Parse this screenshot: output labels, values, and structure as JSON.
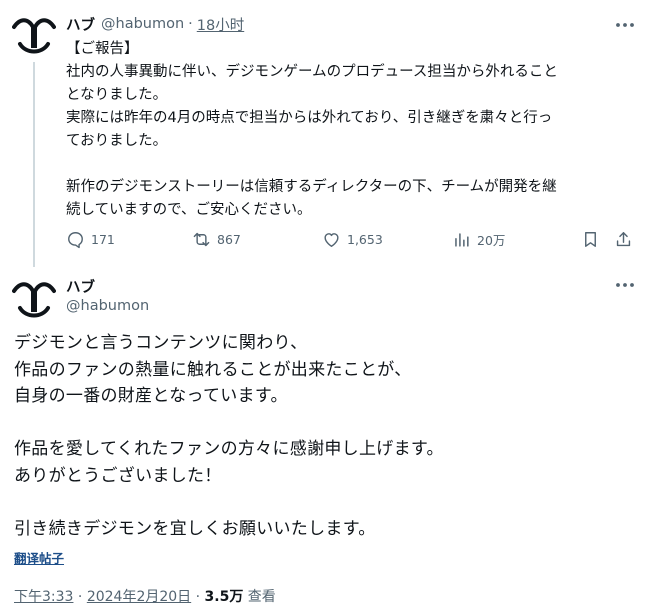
{
  "colors": {
    "text": "#0f1419",
    "secondary": "#536471",
    "line": "#cfd9de",
    "link": "#1d4e89"
  },
  "tweet1": {
    "author_name": "ハブ",
    "handle": "@habumon",
    "separator": "·",
    "time": "18小时",
    "avatar_icon": "avatar-logo-icon",
    "more_icon": "more-dots-icon",
    "body_lines": [
      "【ご報告】",
      "社内の人事異動に伴い、デジモンゲームのプロデュース担当から外れること",
      "となりました。",
      "実際には昨年の4月の時点で担当からは外れており、引き継ぎを粛々と行っ",
      "ておりました。",
      "",
      "新作のデジモンストーリーは信頼するディレクターの下、チームが開発を継",
      "続していますので、ご安心ください。"
    ],
    "actions": {
      "reply_count": "171",
      "retweet_count": "867",
      "like_count": "1,653",
      "views_count": "20万"
    }
  },
  "tweet2": {
    "author_name": "ハブ",
    "handle": "@habumon",
    "more_icon": "more-dots-icon",
    "body_lines": [
      "デジモンと言うコンテンツに関わり、",
      "作品のファンの熱量に触れることが出来たことが、",
      "自身の一番の財産となっています。",
      "",
      "作品を愛してくれたファンの方々に感謝申し上げます。",
      "ありがとうございました！",
      "",
      "引き続きデジモンを宜しくお願いいたします。"
    ],
    "translate_label": "翻译帖子",
    "meta": {
      "time": "下午3:33",
      "date": "2024年2月20日",
      "views_count": "3.5万",
      "views_label": "查看",
      "separator": "·"
    }
  }
}
